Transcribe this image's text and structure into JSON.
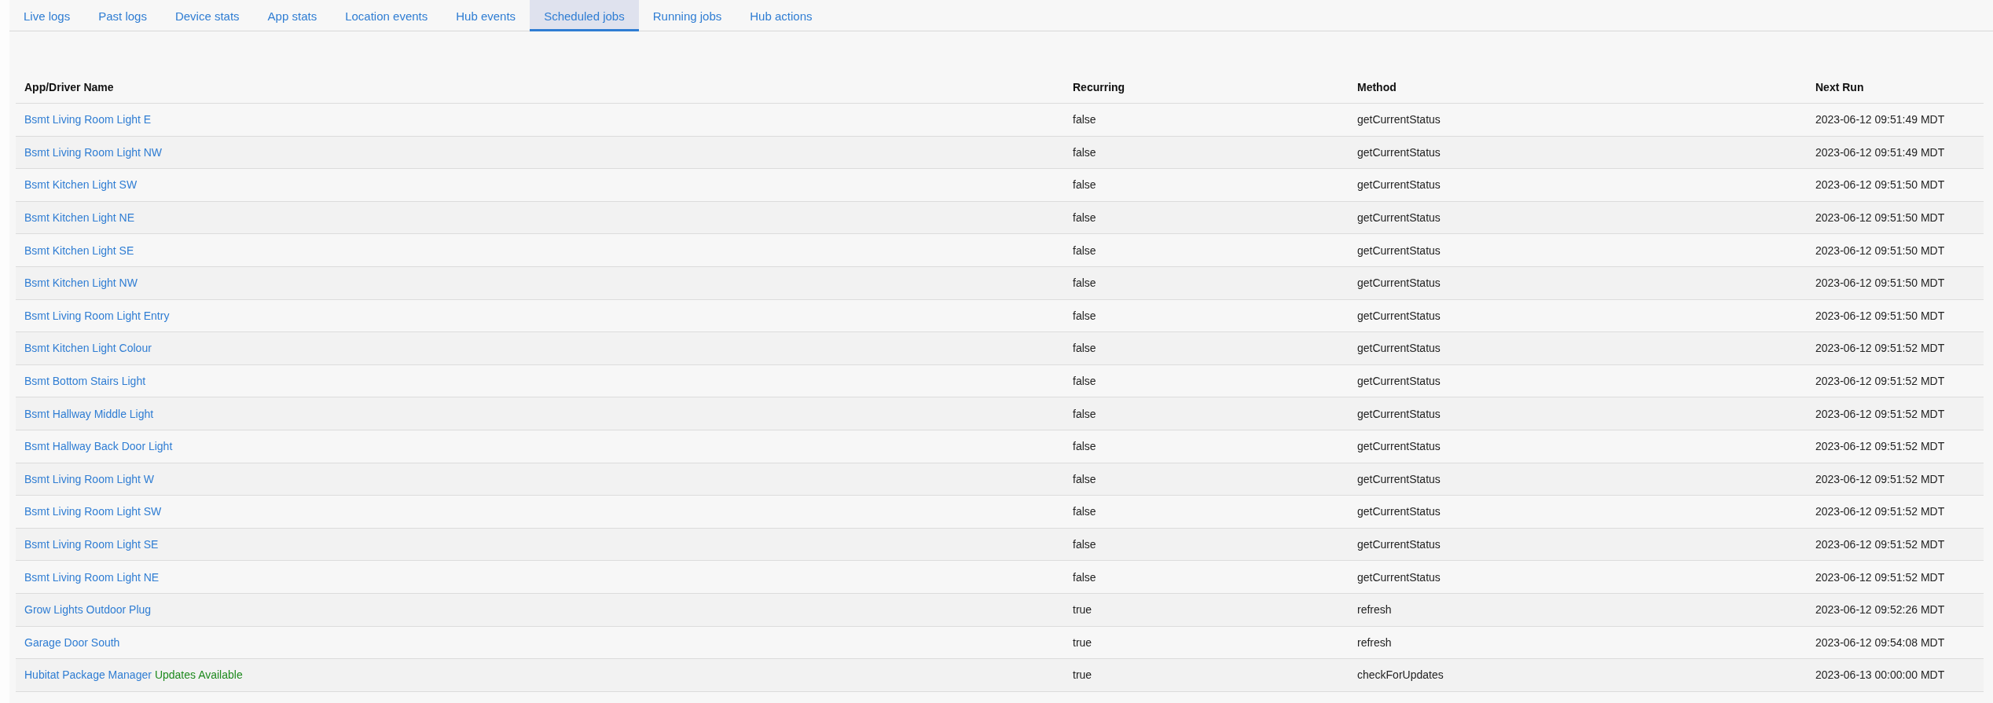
{
  "tabs": [
    {
      "label": "Live logs",
      "selected": false
    },
    {
      "label": "Past logs",
      "selected": false
    },
    {
      "label": "Device stats",
      "selected": false
    },
    {
      "label": "App stats",
      "selected": false
    },
    {
      "label": "Location events",
      "selected": false
    },
    {
      "label": "Hub events",
      "selected": false
    },
    {
      "label": "Scheduled jobs",
      "selected": true
    },
    {
      "label": "Running jobs",
      "selected": false
    },
    {
      "label": "Hub actions",
      "selected": false
    }
  ],
  "table": {
    "columns": [
      "App/Driver Name",
      "Recurring",
      "Method",
      "Next Run"
    ],
    "rows": [
      {
        "name": "Bsmt Living Room Light E",
        "recurring": "false",
        "method": "getCurrentStatus",
        "next_run": "2023-06-12 09:51:49 MDT"
      },
      {
        "name": "Bsmt Living Room Light NW",
        "recurring": "false",
        "method": "getCurrentStatus",
        "next_run": "2023-06-12 09:51:49 MDT"
      },
      {
        "name": "Bsmt Kitchen Light SW",
        "recurring": "false",
        "method": "getCurrentStatus",
        "next_run": "2023-06-12 09:51:50 MDT"
      },
      {
        "name": "Bsmt Kitchen Light NE",
        "recurring": "false",
        "method": "getCurrentStatus",
        "next_run": "2023-06-12 09:51:50 MDT"
      },
      {
        "name": "Bsmt Kitchen Light SE",
        "recurring": "false",
        "method": "getCurrentStatus",
        "next_run": "2023-06-12 09:51:50 MDT"
      },
      {
        "name": "Bsmt Kitchen Light NW",
        "recurring": "false",
        "method": "getCurrentStatus",
        "next_run": "2023-06-12 09:51:50 MDT"
      },
      {
        "name": "Bsmt Living Room Light Entry",
        "recurring": "false",
        "method": "getCurrentStatus",
        "next_run": "2023-06-12 09:51:50 MDT"
      },
      {
        "name": "Bsmt Kitchen Light Colour",
        "recurring": "false",
        "method": "getCurrentStatus",
        "next_run": "2023-06-12 09:51:52 MDT"
      },
      {
        "name": "Bsmt Bottom Stairs Light",
        "recurring": "false",
        "method": "getCurrentStatus",
        "next_run": "2023-06-12 09:51:52 MDT"
      },
      {
        "name": "Bsmt Hallway Middle Light",
        "recurring": "false",
        "method": "getCurrentStatus",
        "next_run": "2023-06-12 09:51:52 MDT"
      },
      {
        "name": "Bsmt Hallway Back Door Light",
        "recurring": "false",
        "method": "getCurrentStatus",
        "next_run": "2023-06-12 09:51:52 MDT"
      },
      {
        "name": "Bsmt Living Room Light W",
        "recurring": "false",
        "method": "getCurrentStatus",
        "next_run": "2023-06-12 09:51:52 MDT"
      },
      {
        "name": "Bsmt Living Room Light SW",
        "recurring": "false",
        "method": "getCurrentStatus",
        "next_run": "2023-06-12 09:51:52 MDT"
      },
      {
        "name": "Bsmt Living Room Light SE",
        "recurring": "false",
        "method": "getCurrentStatus",
        "next_run": "2023-06-12 09:51:52 MDT"
      },
      {
        "name": "Bsmt Living Room Light NE",
        "recurring": "false",
        "method": "getCurrentStatus",
        "next_run": "2023-06-12 09:51:52 MDT"
      },
      {
        "name": "Grow Lights Outdoor Plug",
        "recurring": "true",
        "method": "refresh",
        "next_run": "2023-06-12 09:52:26 MDT"
      },
      {
        "name": "Garage Door South",
        "recurring": "true",
        "method": "refresh",
        "next_run": "2023-06-12 09:54:08 MDT"
      },
      {
        "name": "Hubitat Package Manager",
        "status": "Updates Available",
        "recurring": "true",
        "method": "checkForUpdates",
        "next_run": "2023-06-13 00:00:00 MDT"
      }
    ]
  }
}
